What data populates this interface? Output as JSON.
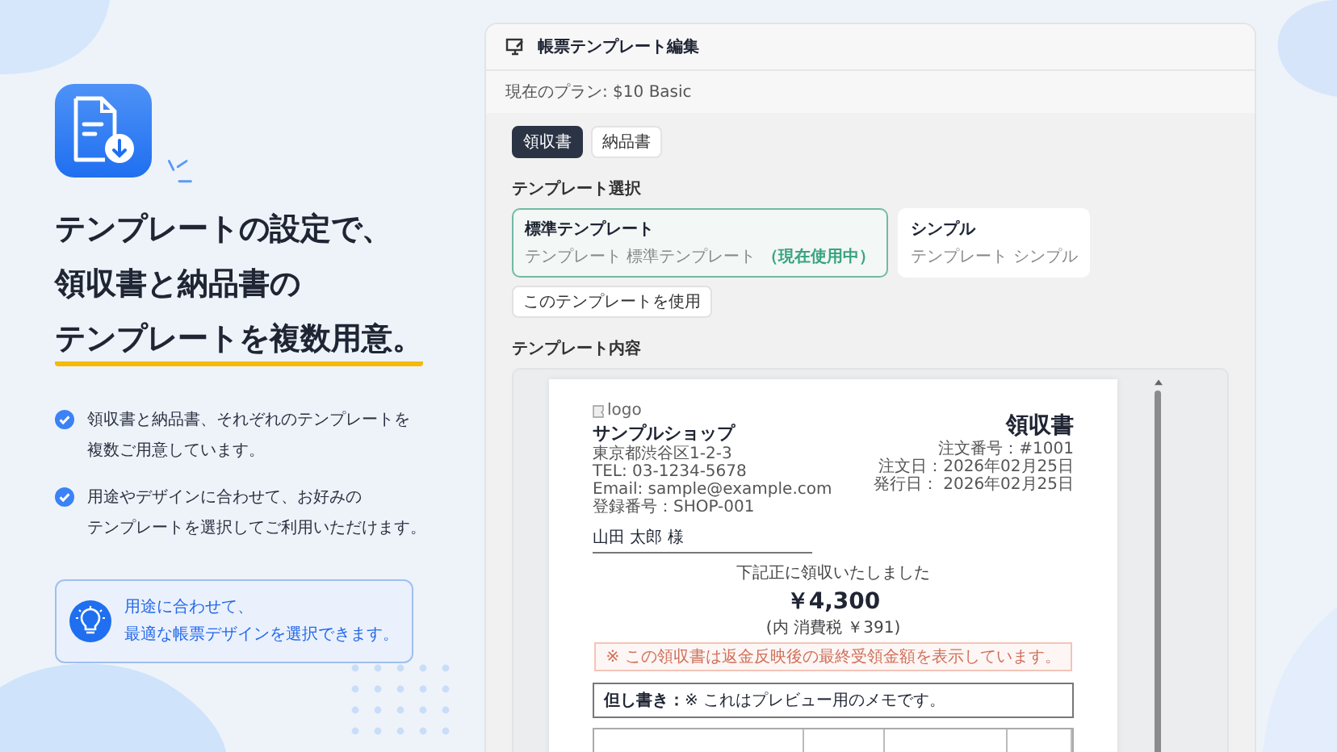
{
  "hero": {
    "headline": [
      {
        "text": "テンプレートの設定で、",
        "underlined": false
      },
      {
        "text": "領収書と納品書の",
        "underlined": false
      },
      {
        "text": "テンプレートを複数用意。",
        "underlined": true
      }
    ]
  },
  "features": [
    {
      "lines": [
        "領収書と納品書、それぞれのテンプレートを",
        "複数ご用意しています。"
      ],
      "checked": true
    },
    {
      "lines": [
        "用途やデザインに合わせて、お好みの",
        "テンプレートを選択してご利用いただけます。"
      ],
      "checked": true
    }
  ],
  "tip": {
    "lines": [
      "用途に合わせて、",
      "最適な帳票デザインを選択できます。"
    ]
  },
  "editor": {
    "title": "帳票テンプレート編集",
    "plan": "現在のプラン: $10 Basic",
    "tabs": [
      {
        "label": "領収書",
        "selected": true
      },
      {
        "label": "納品書",
        "selected": false
      }
    ],
    "template_section": "テンプレート選択",
    "templates": [
      {
        "name": "標準テンプレート",
        "description": "テンプレート 標準テンプレート",
        "status": "（現在使用中）",
        "selected": true
      },
      {
        "name": "シンプル",
        "description": "テンプレート シンプル",
        "selected": false
      }
    ],
    "use_button": "このテンプレートを使用",
    "content_section": "テンプレート内容",
    "document": {
      "logo_alt": "logo",
      "shop_name": "サンプルショップ",
      "shop_lines": [
        "東京都渋谷区1-2-3",
        "TEL: 03-1234-5678",
        "Email: sample@example.com",
        "登録番号：SHOP-001"
      ],
      "title": "領収書",
      "meta": [
        "注文番号：#1001",
        "注文日：2026年02月25日",
        "発行日： 2026年02月25日"
      ],
      "customer": "山田 太郎 様",
      "received": "下記正に領収いたしました",
      "amount": "￥4,300",
      "tax": "(内 消費税 ￥391)",
      "notice": "※ この領収書は返金反映後の最終受領金額を表示しています。",
      "memo_label": "但し書き：",
      "memo_text": "※ これはプレビュー用のメモです。"
    }
  }
}
